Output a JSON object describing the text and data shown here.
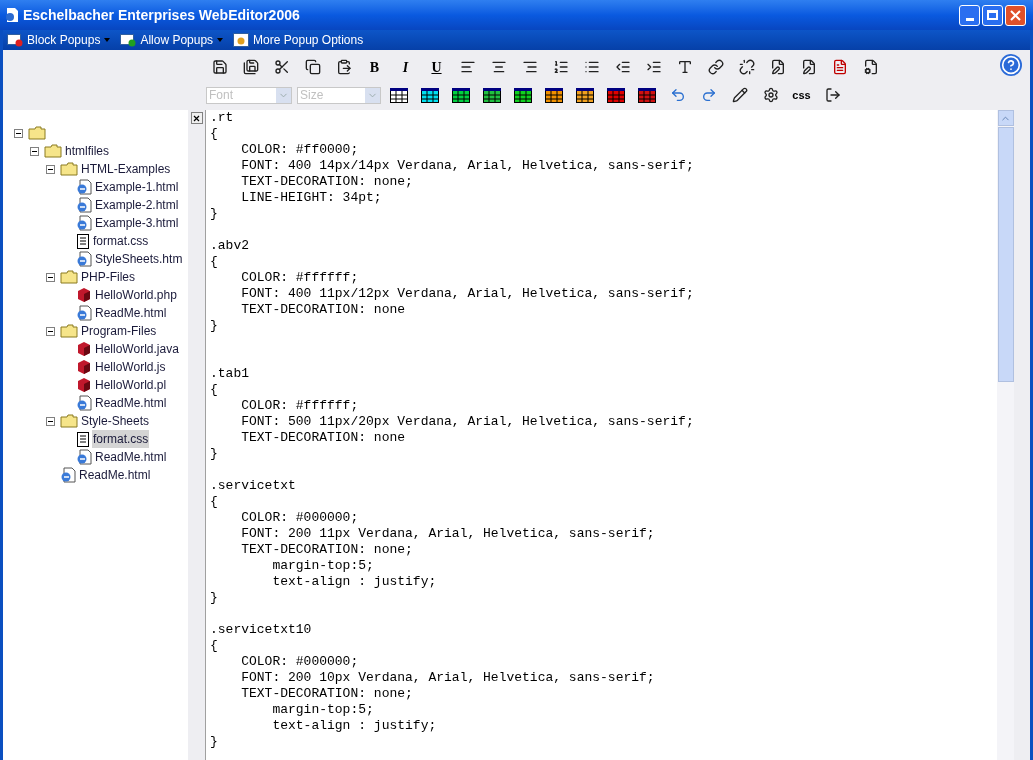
{
  "window": {
    "title": "Eschelbacher Enterprises WebEditor2006"
  },
  "popup_bar": [
    {
      "label": "Block Popups",
      "kind": "block",
      "dropdown": true
    },
    {
      "label": "Allow Popups",
      "kind": "allow",
      "dropdown": true
    },
    {
      "label": "More Popup Options",
      "kind": "more",
      "dropdown": false
    }
  ],
  "toolbar_row_1": [
    {
      "kind": "save"
    },
    {
      "kind": "save-all"
    },
    {
      "kind": "cut"
    },
    {
      "kind": "copy"
    },
    {
      "kind": "paste"
    },
    {
      "kind": "bold",
      "label": "B"
    },
    {
      "kind": "italic",
      "label": "I"
    },
    {
      "kind": "underline",
      "label": "U"
    },
    {
      "kind": "align-left"
    },
    {
      "kind": "align-center"
    },
    {
      "kind": "align-right"
    },
    {
      "kind": "ordered-list"
    },
    {
      "kind": "bullet-list"
    },
    {
      "kind": "outdent"
    },
    {
      "kind": "indent"
    },
    {
      "kind": "text-color"
    },
    {
      "kind": "link"
    },
    {
      "kind": "unlink"
    },
    {
      "kind": "edit-doc"
    },
    {
      "kind": "edit-doc-2"
    },
    {
      "kind": "pdf"
    },
    {
      "kind": "properties"
    }
  ],
  "font_select": {
    "placeholder": "Font"
  },
  "size_select": {
    "placeholder": "Size"
  },
  "toolbar_row_2": [
    {
      "kind": "table",
      "color": "#ffffff"
    },
    {
      "kind": "table",
      "color": "#00e0f0"
    },
    {
      "kind": "table",
      "color": "#00d040"
    },
    {
      "kind": "table",
      "color": "#20c040"
    },
    {
      "kind": "table",
      "color": "#10d020"
    },
    {
      "kind": "table",
      "color": "#f09000"
    },
    {
      "kind": "table",
      "color": "#f0a020"
    },
    {
      "kind": "table",
      "color": "#e00000"
    },
    {
      "kind": "table",
      "color": "#d01010"
    },
    {
      "kind": "undo"
    },
    {
      "kind": "redo"
    },
    {
      "kind": "pencil"
    },
    {
      "kind": "gear-doc"
    },
    {
      "kind": "css",
      "label": "css"
    },
    {
      "kind": "exit"
    }
  ],
  "tree": [
    {
      "kind": "folder",
      "selected": false,
      "children": [
        {
          "kind": "folder",
          "label": "htmlfiles",
          "selected": false,
          "children": [
            {
              "kind": "folder",
              "label": "HTML-Examples",
              "selected": false,
              "children": [
                {
                  "kind": "html",
                  "label": "Example-1.html",
                  "selected": false
                },
                {
                  "kind": "html",
                  "label": "Example-2.html",
                  "selected": false
                },
                {
                  "kind": "html",
                  "label": "Example-3.html",
                  "selected": false
                },
                {
                  "kind": "text",
                  "label": "format.css",
                  "selected": false
                },
                {
                  "kind": "html",
                  "label": "StyleSheets.htm",
                  "selected": false
                }
              ]
            },
            {
              "kind": "folder",
              "label": "PHP-Files",
              "selected": false,
              "children": [
                {
                  "kind": "program",
                  "label": "HelloWorld.php",
                  "selected": false
                },
                {
                  "kind": "html",
                  "label": "ReadMe.html",
                  "selected": false
                }
              ]
            },
            {
              "kind": "folder",
              "label": "Program-Files",
              "selected": false,
              "children": [
                {
                  "kind": "program",
                  "label": "HelloWorld.java",
                  "selected": false
                },
                {
                  "kind": "program",
                  "label": "HelloWorld.js",
                  "selected": false
                },
                {
                  "kind": "program",
                  "label": "HelloWorld.pl",
                  "selected": false
                },
                {
                  "kind": "html",
                  "label": "ReadMe.html",
                  "selected": false
                }
              ]
            },
            {
              "kind": "folder",
              "label": "Style-Sheets",
              "selected": false,
              "children": [
                {
                  "kind": "text",
                  "label": "format.css",
                  "selected": true
                },
                {
                  "kind": "html",
                  "label": "ReadMe.html",
                  "selected": false
                }
              ]
            },
            {
              "kind": "html",
              "label": "ReadMe.html",
              "selected": false
            }
          ]
        }
      ]
    }
  ],
  "editor": {
    "text": ".rt\n{\n    COLOR: #ff0000;\n    FONT: 400 14px/14px Verdana, Arial, Helvetica, sans-serif;\n    TEXT-DECORATION: none;\n    LINE-HEIGHT: 34pt;\n}\n\n.abv2\n{\n    COLOR: #ffffff;\n    FONT: 400 11px/12px Verdana, Arial, Helvetica, sans-serif;\n    TEXT-DECORATION: none\n}\n\n\n.tab1\n{\n    COLOR: #ffffff;\n    FONT: 500 11px/20px Verdana, Arial, Helvetica, sans-serif;\n    TEXT-DECORATION: none\n}\n\n.servicetxt\n{\n    COLOR: #000000;\n    FONT: 200 11px Verdana, Arial, Helvetica, sans-serif;\n    TEXT-DECORATION: none;\n        margin-top:5;\n        text-align : justify;\n}\n\n.servicetxt10\n{\n    COLOR: #000000;\n    FONT: 200 10px Verdana, Arial, Helvetica, sans-serif;\n    TEXT-DECORATION: none;\n        margin-top:5;\n        text-align : justify;\n}"
  }
}
